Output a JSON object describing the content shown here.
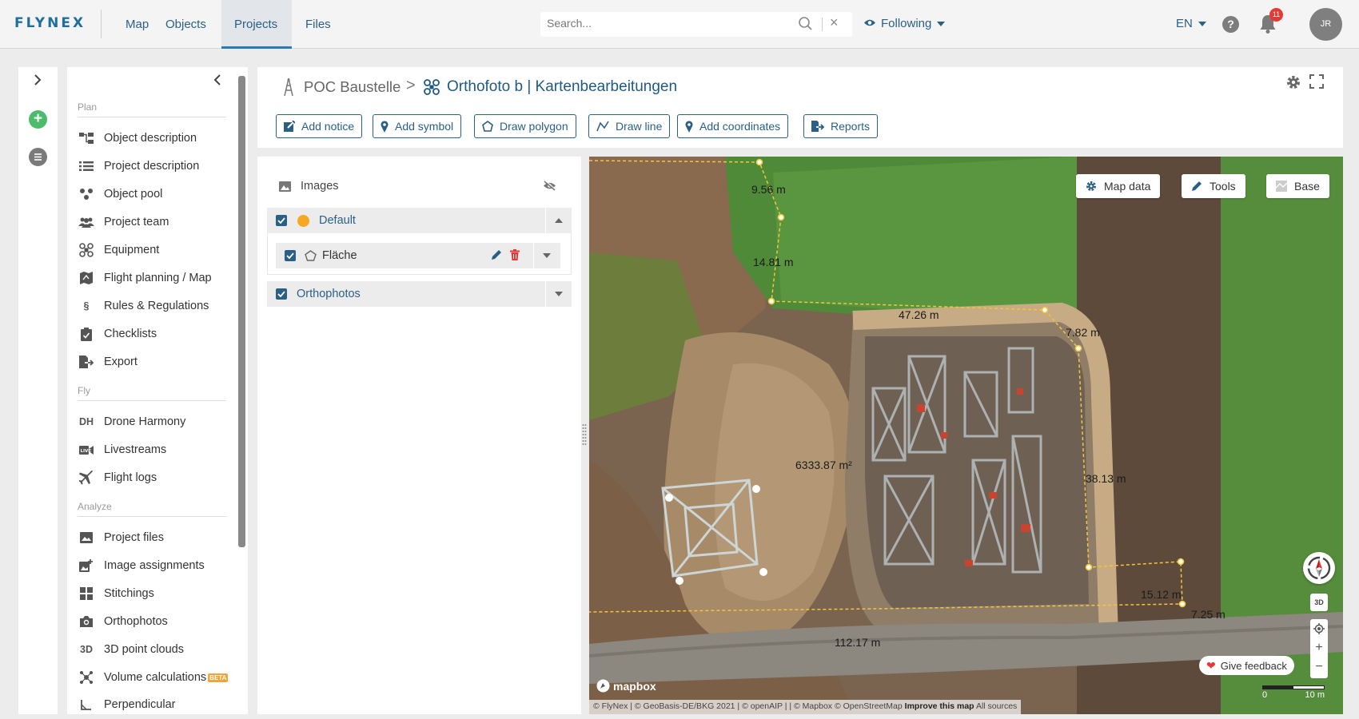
{
  "app": {
    "logo": "FLYNEX",
    "nav": [
      "Map",
      "Objects",
      "Projects",
      "Files"
    ],
    "active_nav": "Projects",
    "search_placeholder": "Search...",
    "following": "Following",
    "lang": "EN",
    "help": "?",
    "notification_count": "11",
    "avatar": "JR"
  },
  "sidebar": {
    "sections": [
      {
        "title": "Plan",
        "items": [
          "Object description",
          "Project description",
          "Object pool",
          "Project team",
          "Equipment",
          "Flight planning / Map",
          "Rules & Regulations",
          "Checklists",
          "Export"
        ]
      },
      {
        "title": "Fly",
        "items": [
          "Drone Harmony",
          "Livestreams",
          "Flight logs"
        ]
      },
      {
        "title": "Analyze",
        "items": [
          "Project files",
          "Image assignments",
          "Stitchings",
          "Orthophotos",
          "3D point clouds",
          "Volume calculations",
          "Perpendicular"
        ]
      }
    ],
    "beta_label": "BETA",
    "icon_text": {
      "drone_harmony": "DH",
      "point_clouds": "3D",
      "rules": "§"
    }
  },
  "header": {
    "crumb_object": "POC Baustelle",
    "crumb_separator": ">",
    "crumb_project": "Orthofoto b | Kartenbearbeitungen",
    "toolbar": [
      "Add notice",
      "Add symbol",
      "Draw polygon",
      "Draw line",
      "Add coordinates",
      "Reports"
    ]
  },
  "layers": {
    "images_label": "Images",
    "groups": [
      {
        "name": "Default",
        "checked": true,
        "color": "#f6a823",
        "expanded": true,
        "children": [
          {
            "name": "Fläche",
            "checked": true
          }
        ]
      },
      {
        "name": "Orthophotos",
        "checked": true,
        "expanded": false
      }
    ]
  },
  "map": {
    "buttons": [
      "Map data",
      "Tools",
      "Base"
    ],
    "three_d": "3D",
    "zoom_in": "+",
    "zoom_out": "−",
    "feedback": "Give feedback",
    "mapbox": "mapbox",
    "attribution": "© FlyNex | © GeoBasis-DE/BKG 2021 | © openAIP | | © Mapbox © OpenStreetMap",
    "attribution_improve": "Improve this map",
    "attribution_sources": "All sources",
    "scale": {
      "start": "0",
      "end": "10 m"
    },
    "measurements": [
      "9.56 m",
      "14.81 m",
      "47.26 m",
      "7.82 m",
      "6333.87 m²",
      "38.13 m",
      "15.12 m",
      "7.25 m",
      "112.17 m"
    ],
    "colors": {
      "measure_line": "#f2c53a",
      "accent": "#2a5f86"
    }
  }
}
